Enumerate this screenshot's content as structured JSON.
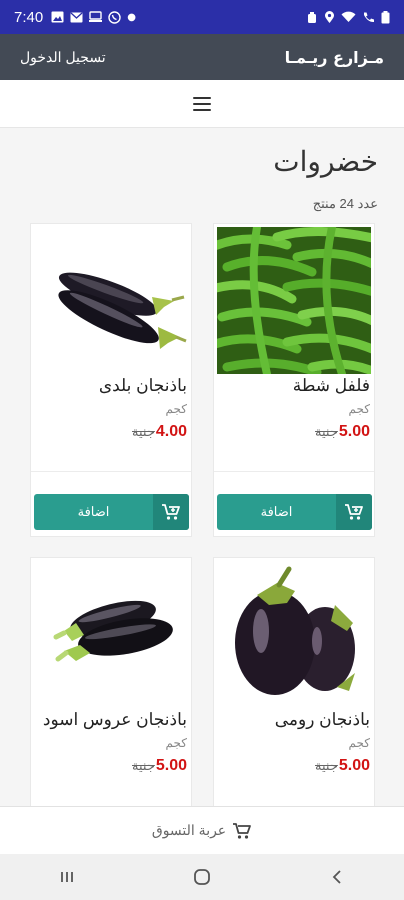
{
  "status_bar": {
    "time": "7:40",
    "left_icons": [
      "image-icon",
      "mail-icon",
      "screen-icon",
      "whatsapp-icon",
      "dot"
    ],
    "right_icons": [
      "alarm-icon",
      "location-icon",
      "wifi-icon",
      "call-icon",
      "battery-icon"
    ]
  },
  "header": {
    "brand": "مـزارع ريـمـا",
    "login": "تسجيل الدخول"
  },
  "page": {
    "title": "خضروات",
    "count": "عدد 24 منتج"
  },
  "products": [
    {
      "name": "فلفل شطة",
      "unit": "كجم",
      "price": "5.00",
      "currency": "جنية",
      "add_label": "اضافة"
    },
    {
      "name": "باذنجان بلدى",
      "unit": "كجم",
      "price": "4.00",
      "currency": "جنية",
      "add_label": "اضافة"
    },
    {
      "name": "باذنجان رومى",
      "unit": "كجم",
      "price": "5.00",
      "currency": "جنية"
    },
    {
      "name": "باذنجان عروس اسود",
      "unit": "كجم",
      "price": "5.00",
      "currency": "جنية"
    }
  ],
  "cart_bar": {
    "label": "عربة التسوق"
  },
  "colors": {
    "status_bar": "#2b2fa8",
    "header": "#434a55",
    "button": "#2a9d8f",
    "price": "#d21414"
  }
}
